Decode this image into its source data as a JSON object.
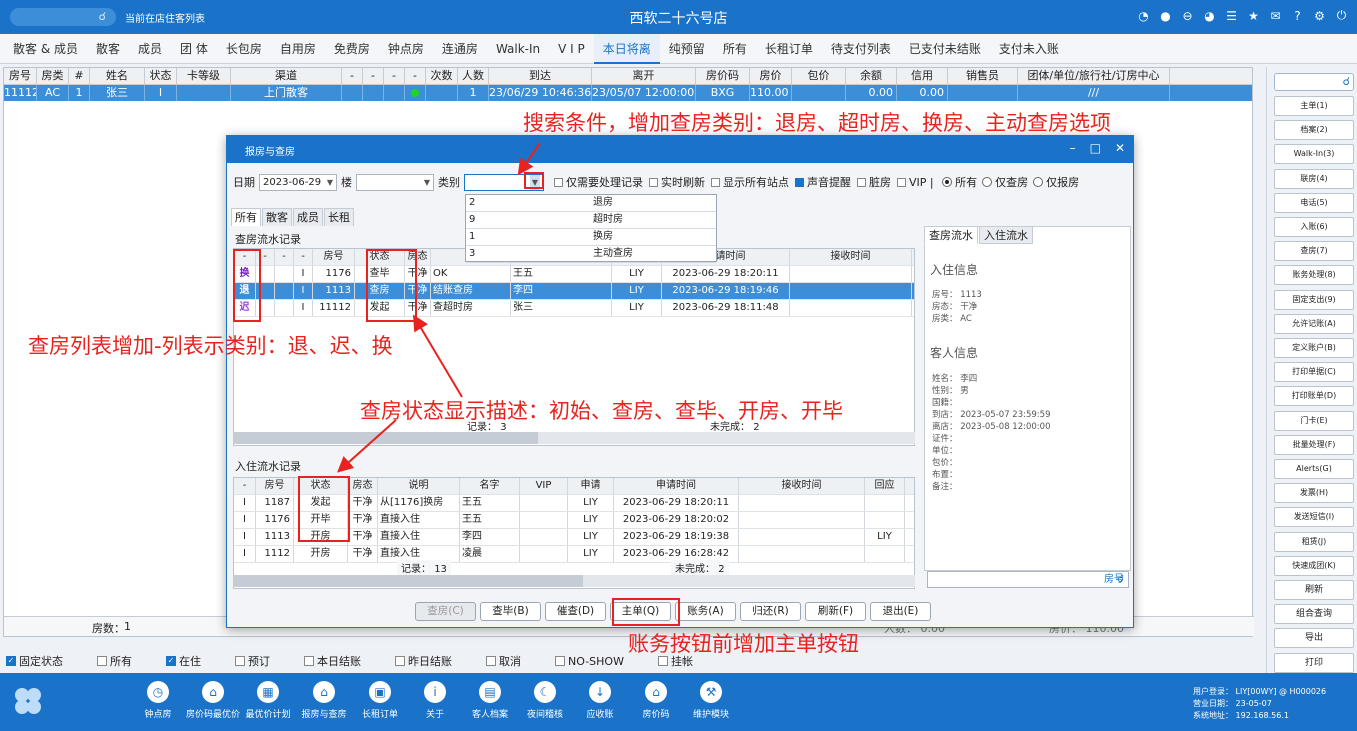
{
  "topbar": {
    "guest_list_label": "当前在店住客列表",
    "hotel_name": "西软二十六号店",
    "icons": [
      "wifi-icon",
      "chat-icon",
      "minus-circle-icon",
      "palette-icon",
      "menu-icon",
      "star-icon",
      "mail-icon",
      "help-icon",
      "gear-icon",
      "power-icon"
    ]
  },
  "tabs": [
    "散客 & 成员",
    "散客",
    "成员",
    "团 体",
    "长包房",
    "自用房",
    "免费房",
    "钟点房",
    "连通房",
    "Walk-In",
    "V I P",
    "本日将离",
    "纯预留",
    "所有",
    "长租订单",
    "待支付列表",
    "已支付未结账",
    "支付未入账"
  ],
  "active_tab": "本日将离",
  "grid": {
    "columns": [
      "房号",
      "房类",
      "#",
      "姓名",
      "状态",
      "卡等级",
      "渠道",
      "-",
      "-",
      "-",
      "-",
      "次数",
      "人数",
      "到达",
      "离开",
      "房价码",
      "房价",
      "包价",
      "余额",
      "信用",
      "销售员",
      "团体/单位/旅行社/订房中心"
    ],
    "row": [
      "11112",
      "AC",
      "1",
      "张三",
      "I",
      "",
      "上门散客",
      "",
      "",
      "",
      "",
      "",
      "1",
      "23/06/29 10:46:36",
      "23/05/07 12:00:00",
      "BXG",
      "110.00",
      "",
      "0.00",
      "0.00",
      "",
      "///"
    ],
    "footer_rooms": "房数：",
    "footer_rooms_value": "1",
    "footer_mid": "人数：  0.00",
    "footer_right": "房价：  110.00"
  },
  "filters": [
    {
      "label": "固定状态",
      "checked": true
    },
    {
      "label": "所有",
      "checked": false
    },
    {
      "label": "在住",
      "checked": true
    },
    {
      "label": "预订",
      "checked": false
    },
    {
      "label": "本日结账",
      "checked": false
    },
    {
      "label": "昨日结账",
      "checked": false
    },
    {
      "label": "取消",
      "checked": false
    },
    {
      "label": "NO-SHOW",
      "checked": false
    },
    {
      "label": "挂帐",
      "checked": false
    }
  ],
  "sidebar": {
    "buttons": [
      "主单(1)",
      "档案(2)",
      "Walk-In(3)",
      "联房(4)",
      "电话(5)",
      "入账(6)",
      "查房(7)",
      "账务处理(8)",
      "固定支出(9)",
      "允许记账(A)",
      "定义账户(B)",
      "打印单据(C)",
      "打印账单(D)",
      "门卡(E)",
      "批量处理(F)",
      "Alerts(G)",
      "发票(H)",
      "发送短信(I)",
      "租赁(J)",
      "快速成团(K)",
      "刷新",
      "组合查询",
      "导出",
      "打印"
    ]
  },
  "bottombar": {
    "nav": [
      {
        "label": "钟点房",
        "icon": "clock-icon"
      },
      {
        "label": "房价码最优价",
        "icon": "house-tag-icon"
      },
      {
        "label": "最优价计划",
        "icon": "calendar-icon"
      },
      {
        "label": "报房与查房",
        "icon": "home-check-icon"
      },
      {
        "label": "长租订单",
        "icon": "briefcase-icon"
      },
      {
        "label": "关于",
        "icon": "info-icon"
      },
      {
        "label": "客人档案",
        "icon": "id-card-icon"
      },
      {
        "label": "夜间稽核",
        "icon": "moon-icon"
      },
      {
        "label": "应收账",
        "icon": "download-icon"
      },
      {
        "label": "房价码",
        "icon": "house-icon"
      },
      {
        "label": "维护模块",
        "icon": "wrench-icon"
      }
    ],
    "user_login": "用户登录：  LIY[00WY] @ H000026",
    "business_date": "营业日期：  23-05-07",
    "system_address": "系统地址：  192.168.56.1"
  },
  "dialog": {
    "title": "报房与查房",
    "date_label": "日期",
    "date_value": "2023-06-29",
    "building_label": "楼",
    "category_label": "类别",
    "checks": [
      {
        "label": "仅需要处理记录",
        "checked": false
      },
      {
        "label": "实时刷新",
        "checked": false
      },
      {
        "label": "显示所有站点",
        "checked": false
      },
      {
        "label": "声音提醒",
        "checked": true
      },
      {
        "label": "脏房",
        "checked": false
      },
      {
        "label": "VIP",
        "checked": false
      }
    ],
    "radios": [
      {
        "label": "所有",
        "checked": true
      },
      {
        "label": "仅查房",
        "checked": false
      },
      {
        "label": "仅报房",
        "checked": false
      }
    ],
    "category_options": [
      {
        "code": "2",
        "name": "退房"
      },
      {
        "code": "9",
        "name": "超时房"
      },
      {
        "code": "1",
        "name": "换房"
      },
      {
        "code": "3",
        "name": "主动查房"
      }
    ],
    "subtabs": [
      "所有",
      "散客",
      "成员",
      "长租"
    ],
    "check_section_title": "查房流水记录",
    "check_table": {
      "columns": [
        "-",
        "-",
        "-",
        "-",
        "房号",
        "状态",
        "房态",
        "",
        "",
        "",
        "申请时间",
        "接收时间"
      ],
      "rows": [
        {
          "type": "换",
          "flag": "I",
          "room": "1176",
          "status": "查毕",
          "hstate": "干净",
          "note": "OK",
          "name": "王五",
          "user": "LIY",
          "time": "2023-06-29 18:20:11",
          "selected": false
        },
        {
          "type": "退",
          "flag": "I",
          "room": "1113",
          "status": "查房",
          "hstate": "干净",
          "note": "结账查房",
          "name": "李四",
          "user": "LIY",
          "time": "2023-06-29 18:19:46",
          "selected": true
        },
        {
          "type": "迟",
          "flag": "I",
          "room": "11112",
          "status": "发起",
          "hstate": "干净",
          "note": "查超时房",
          "name": "张三",
          "user": "LIY",
          "time": "2023-06-29 18:11:48",
          "selected": false
        }
      ],
      "records_label": "记录：",
      "records_value": "3",
      "unfinished_label": "未完成：",
      "unfinished_value": "2"
    },
    "checkin_section_title": "入住流水记录",
    "checkin_table": {
      "columns": [
        "-",
        "房号",
        "状态",
        "房态",
        "说明",
        "名字",
        "VIP",
        "申请",
        "申请时间",
        "接收时间",
        "回应"
      ],
      "rows": [
        {
          "flag": "I",
          "room": "1187",
          "status": "发起",
          "hstate": "干净",
          "note": "从[1176]换房",
          "name": "王五",
          "vip": "",
          "user": "LIY",
          "time": "2023-06-29 18:20:11",
          "reply": ""
        },
        {
          "flag": "I",
          "room": "1176",
          "status": "开毕",
          "hstate": "干净",
          "note": "直接入住",
          "name": "王五",
          "vip": "",
          "user": "LIY",
          "time": "2023-06-29 18:20:02",
          "reply": ""
        },
        {
          "flag": "I",
          "room": "1113",
          "status": "开房",
          "hstate": "干净",
          "note": "直接入住",
          "name": "李四",
          "vip": "",
          "user": "LIY",
          "time": "2023-06-29 18:19:38",
          "reply": "LIY"
        },
        {
          "flag": "I",
          "room": "1112",
          "status": "开房",
          "hstate": "干净",
          "note": "直接入住",
          "name": "凌晨",
          "vip": "",
          "user": "LIY",
          "time": "2023-06-29 16:28:42",
          "reply": ""
        }
      ],
      "records_label": "记录：",
      "records_value": "13",
      "unfinished_label": "未完成：",
      "unfinished_value": "2"
    },
    "right_tabs": [
      "查房流水",
      "入住流水"
    ],
    "checkin_info_title": "入住信息",
    "checkin_info": [
      "房号：  1113",
      "房态：  干净",
      "房类：  AC"
    ],
    "guest_info_title": "客人信息",
    "guest_info": [
      "姓名：  李四",
      "性别：  男",
      "国籍：",
      "到店：  2023-05-07 23:59:59",
      "离店：  2023-05-08 12:00:00",
      "证件：",
      "单位：",
      "包价：",
      "布置：",
      "备注："
    ],
    "room_search_placeholder": "房号",
    "buttons": [
      {
        "label": "查房(C)",
        "disabled": true
      },
      {
        "label": "查毕(B)",
        "disabled": false
      },
      {
        "label": "催查(D)",
        "disabled": false
      },
      {
        "label": "主单(Q)",
        "disabled": false
      },
      {
        "label": "账务(A)",
        "disabled": false
      },
      {
        "label": "归还(R)",
        "disabled": false
      },
      {
        "label": "刷新(F)",
        "disabled": false
      },
      {
        "label": "退出(E)",
        "disabled": false
      }
    ]
  },
  "annotations": {
    "search_conditions": "搜索条件，增加查房类别：退房、超时房、换房、主动查房选项",
    "list_category": "查房列表增加-列表示类别：退、迟、换",
    "status_desc": "查房状态显示描述：初始、查房、查毕、开房、开毕",
    "master_button": "账务按钮前增加主单按钮"
  },
  "colors": {
    "brand": "#1a73c8",
    "selection": "#3d8ed8",
    "annotation": "#e8231f"
  }
}
